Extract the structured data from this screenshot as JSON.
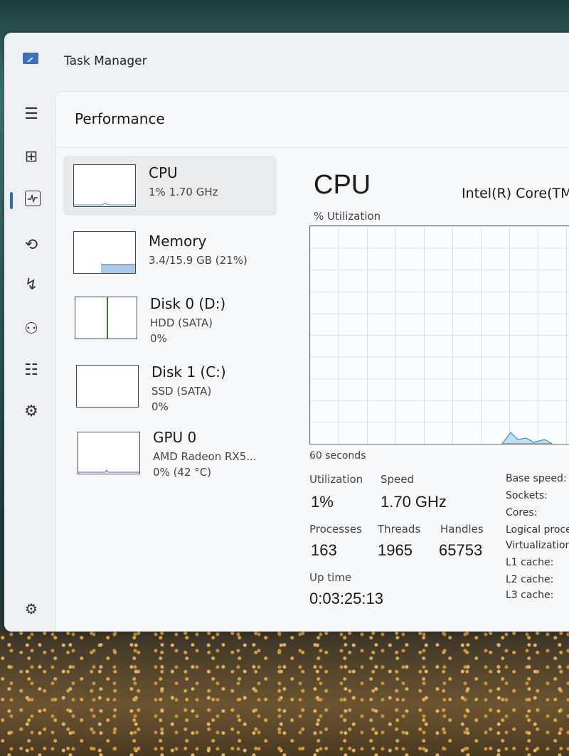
{
  "window": {
    "title": "Task Manager"
  },
  "rail": {
    "items": [
      {
        "icon": "hamburger-menu-icon",
        "glyph": "☰"
      },
      {
        "icon": "processes-icon",
        "glyph": "⊞"
      },
      {
        "icon": "performance-icon",
        "glyph": "⧄"
      },
      {
        "icon": "app-history-icon",
        "glyph": "⟲"
      },
      {
        "icon": "startup-apps-icon",
        "glyph": "↯"
      },
      {
        "icon": "users-icon",
        "glyph": "⚇"
      },
      {
        "icon": "details-icon",
        "glyph": "☷"
      },
      {
        "icon": "services-icon",
        "glyph": "⚙"
      }
    ],
    "settings_icon": "settings-icon",
    "settings_glyph": "⚙"
  },
  "page": {
    "title": "Performance"
  },
  "sidebar": {
    "items": [
      {
        "name": "CPU",
        "line1": "1% 1.70 GHz",
        "line2": ""
      },
      {
        "name": "Memory",
        "line1": "3.4/15.9 GB (21%)",
        "line2": ""
      },
      {
        "name": "Disk 0 (D:)",
        "line1": "HDD (SATA)",
        "line2": "0%"
      },
      {
        "name": "Disk 1 (C:)",
        "line1": "SSD (SATA)",
        "line2": "0%"
      },
      {
        "name": "GPU 0",
        "line1": "AMD Radeon RX5...",
        "line2": "0% (42 °C)"
      }
    ]
  },
  "detail": {
    "heading": "CPU",
    "model": "Intel(R) Core(TM",
    "graph_label": "% Utilization",
    "time_label": "60 seconds",
    "stats": {
      "utilization_label": "Utilization",
      "utilization": "1%",
      "speed_label": "Speed",
      "speed": "1.70 GHz",
      "processes_label": "Processes",
      "processes": "163",
      "threads_label": "Threads",
      "threads": "1965",
      "handles_label": "Handles",
      "handles": "65753",
      "uptime_label": "Up time",
      "uptime": "0:03:25:13"
    },
    "specs": [
      "Base speed:",
      "Sockets:",
      "Cores:",
      "Logical proces",
      "Virtualization:",
      "L1 cache:",
      "L2 cache:",
      "L3 cache:"
    ]
  },
  "colors": {
    "accent": "#2f6db5",
    "memory_fill": "#a9c9ea",
    "disk_line": "#3d7a2e",
    "graph_line": "#3a8fcf"
  }
}
